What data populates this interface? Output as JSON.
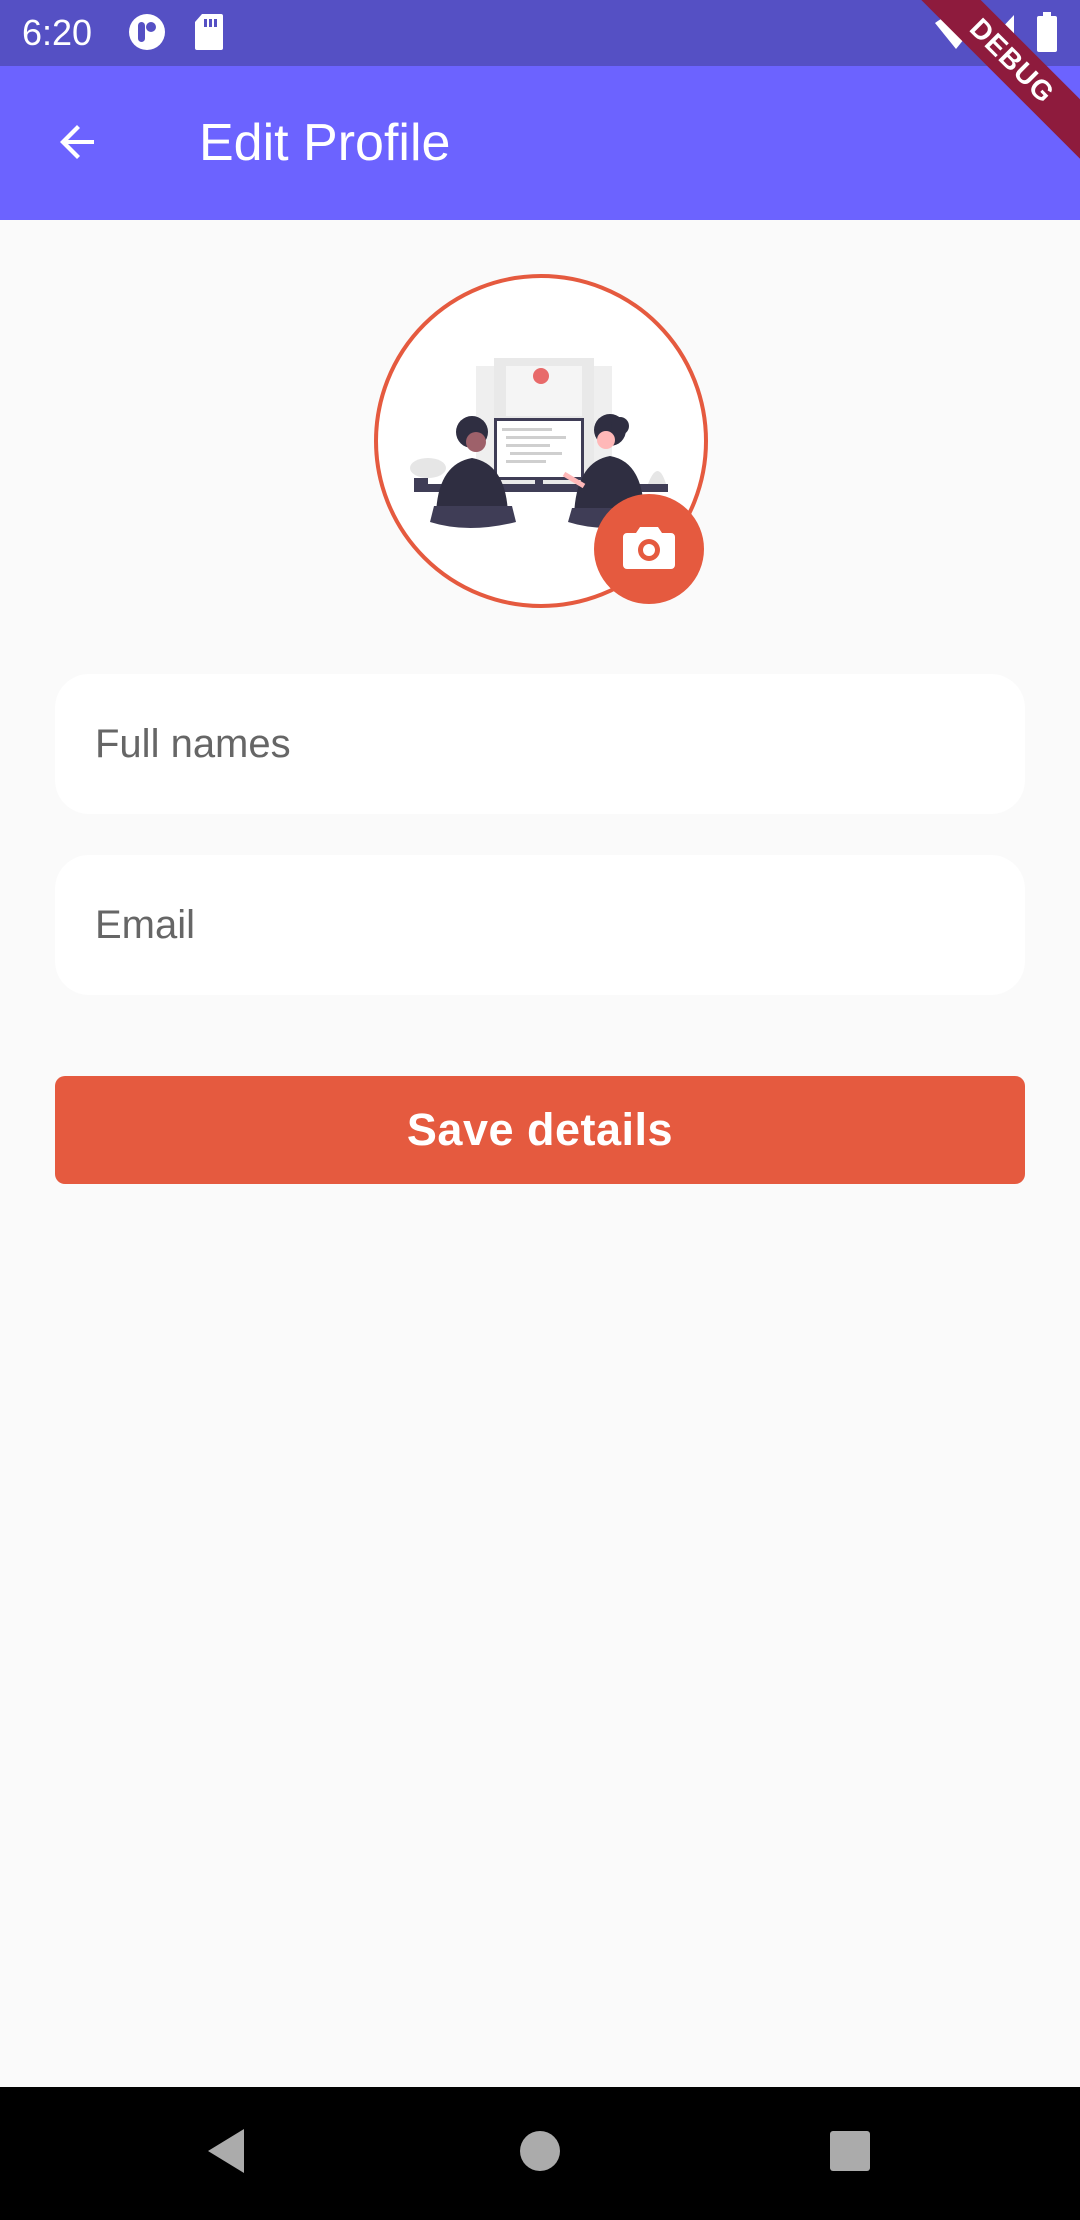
{
  "status_bar": {
    "time": "6:20",
    "icons": [
      "app-notification-icon",
      "sd-card-icon",
      "wifi-icon",
      "signal-icon",
      "battery-icon"
    ]
  },
  "debug_banner": {
    "label": "DEBUG"
  },
  "app_bar": {
    "title": "Edit Profile",
    "back_icon": "arrow-back-icon"
  },
  "profile": {
    "avatar_icon": "profile-illustration",
    "camera_icon": "camera-icon"
  },
  "form": {
    "full_names": {
      "value": "",
      "placeholder": "Full names"
    },
    "email": {
      "value": "",
      "placeholder": "Email"
    },
    "save_label": "Save details"
  },
  "nav": {
    "icons": [
      "back-triangle-icon",
      "home-circle-icon",
      "recents-square-icon"
    ]
  },
  "colors": {
    "app_bar": "#6C63FF",
    "status_bar": "#5550C4",
    "accent": "#E55A3F",
    "background": "#FAFAFA"
  }
}
